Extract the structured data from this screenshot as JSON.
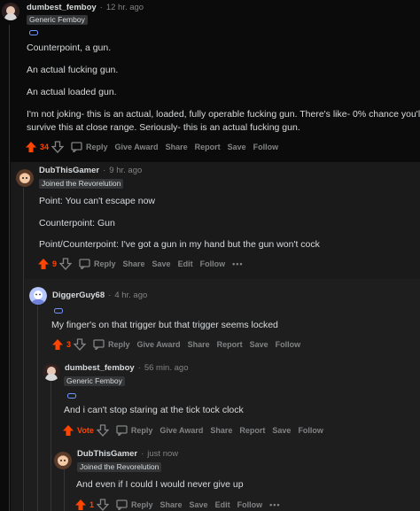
{
  "colors": {
    "accent": "#ff4500",
    "background": "#0b0b0b",
    "panel": "#1a1a1b",
    "text": "#d7dadc",
    "muted": "#818384"
  },
  "comments": [
    {
      "user": "dumbest_femboy",
      "time": "12 hr. ago",
      "flair": "Generic Femboy",
      "body": [
        "Counterpoint, a gun.",
        "An actual fucking gun.",
        "An actual loaded gun.",
        "I'm not joking- this is an actual, loaded, fully operable fucking gun. There's like- 0% chance you'll",
        "survive this at close range. Seriously- this is an actual fucking gun."
      ],
      "score": "34",
      "actions": [
        "Reply",
        "Give Award",
        "Share",
        "Report",
        "Save",
        "Follow"
      ]
    },
    {
      "user": "DubThisGamer",
      "time": "9 hr. ago",
      "flair": "Joined the Revorelution",
      "body": [
        "Point: You can't escape now",
        "Counterpoint: Gun",
        "Point/Counterpoint: I've got a gun in my hand but the gun won't cock"
      ],
      "score": "9",
      "actions": [
        "Reply",
        "Share",
        "Save",
        "Edit",
        "Follow"
      ],
      "more": "•••"
    },
    {
      "user": "DiggerGuy68",
      "time": "4 hr. ago",
      "body": [
        "My finger's on that trigger but that trigger seems locked"
      ],
      "score": "3",
      "actions": [
        "Reply",
        "Give Award",
        "Share",
        "Report",
        "Save",
        "Follow"
      ]
    },
    {
      "user": "dumbest_femboy",
      "time": "56 min. ago",
      "flair": "Generic Femboy",
      "body": [
        "And i can't stop staring at the tick tock clock"
      ],
      "score": "Vote",
      "actions": [
        "Reply",
        "Give Award",
        "Share",
        "Report",
        "Save",
        "Follow"
      ]
    },
    {
      "user": "DubThisGamer",
      "time": "just now",
      "flair": "Joined the Revorelution",
      "body": [
        "And even if I could I would never give up"
      ],
      "score": "1",
      "actions": [
        "Reply",
        "Share",
        "Save",
        "Edit",
        "Follow"
      ],
      "more": "•••"
    }
  ]
}
